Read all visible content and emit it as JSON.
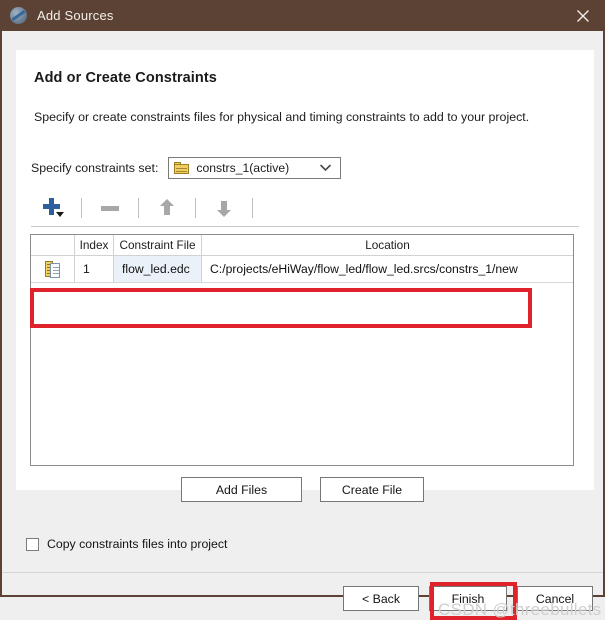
{
  "window": {
    "title": "Add Sources",
    "icon": "app-globe-icon",
    "close_icon": "close-icon",
    "titlebar_color": "#5b4234"
  },
  "page": {
    "title": "Add or Create Constraints",
    "subtitle": "Specify or create constraints files for physical and timing constraints to add to your project."
  },
  "constraint_set": {
    "label": "Specify constraints set:",
    "value": "constrs_1(active)",
    "icon": "folder-icon",
    "chevron_icon": "chevron-down-icon"
  },
  "toolbar": {
    "buttons": [
      {
        "name": "add-sources-button",
        "icon": "plus-icon"
      },
      {
        "name": "remove-sources-button",
        "icon": "minus-icon"
      },
      {
        "name": "move-up-button",
        "icon": "arrow-up-icon"
      },
      {
        "name": "move-down-button",
        "icon": "arrow-down-icon"
      }
    ]
  },
  "table": {
    "columns": [
      "",
      "Index",
      "Constraint File",
      "Location"
    ],
    "rows": [
      {
        "icon": "constraint-file-icon",
        "index": "1",
        "file": "flow_led.edc",
        "location": "C:/projects/eHiWay/flow_led/flow_led.srcs/constrs_1/new"
      }
    ]
  },
  "mid_buttons": {
    "add_files": "Add Files",
    "create_file": "Create File"
  },
  "copy_option": {
    "label": "Copy constraints files into project",
    "checked": false
  },
  "footer": {
    "back": "< Back",
    "finish": "Finish",
    "cancel": "Cancel"
  },
  "annotations": {
    "highlight_color": "#e0232b",
    "watermark": "CSDN @threebullets"
  }
}
